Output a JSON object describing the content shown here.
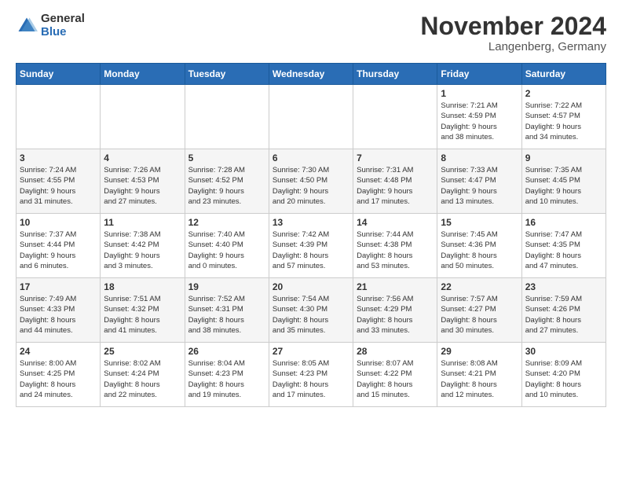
{
  "header": {
    "logo_general": "General",
    "logo_blue": "Blue",
    "title": "November 2024",
    "location": "Langenberg, Germany"
  },
  "columns": [
    "Sunday",
    "Monday",
    "Tuesday",
    "Wednesday",
    "Thursday",
    "Friday",
    "Saturday"
  ],
  "weeks": [
    [
      {
        "day": "",
        "info": ""
      },
      {
        "day": "",
        "info": ""
      },
      {
        "day": "",
        "info": ""
      },
      {
        "day": "",
        "info": ""
      },
      {
        "day": "",
        "info": ""
      },
      {
        "day": "1",
        "info": "Sunrise: 7:21 AM\nSunset: 4:59 PM\nDaylight: 9 hours\nand 38 minutes."
      },
      {
        "day": "2",
        "info": "Sunrise: 7:22 AM\nSunset: 4:57 PM\nDaylight: 9 hours\nand 34 minutes."
      }
    ],
    [
      {
        "day": "3",
        "info": "Sunrise: 7:24 AM\nSunset: 4:55 PM\nDaylight: 9 hours\nand 31 minutes."
      },
      {
        "day": "4",
        "info": "Sunrise: 7:26 AM\nSunset: 4:53 PM\nDaylight: 9 hours\nand 27 minutes."
      },
      {
        "day": "5",
        "info": "Sunrise: 7:28 AM\nSunset: 4:52 PM\nDaylight: 9 hours\nand 23 minutes."
      },
      {
        "day": "6",
        "info": "Sunrise: 7:30 AM\nSunset: 4:50 PM\nDaylight: 9 hours\nand 20 minutes."
      },
      {
        "day": "7",
        "info": "Sunrise: 7:31 AM\nSunset: 4:48 PM\nDaylight: 9 hours\nand 17 minutes."
      },
      {
        "day": "8",
        "info": "Sunrise: 7:33 AM\nSunset: 4:47 PM\nDaylight: 9 hours\nand 13 minutes."
      },
      {
        "day": "9",
        "info": "Sunrise: 7:35 AM\nSunset: 4:45 PM\nDaylight: 9 hours\nand 10 minutes."
      }
    ],
    [
      {
        "day": "10",
        "info": "Sunrise: 7:37 AM\nSunset: 4:44 PM\nDaylight: 9 hours\nand 6 minutes."
      },
      {
        "day": "11",
        "info": "Sunrise: 7:38 AM\nSunset: 4:42 PM\nDaylight: 9 hours\nand 3 minutes."
      },
      {
        "day": "12",
        "info": "Sunrise: 7:40 AM\nSunset: 4:40 PM\nDaylight: 9 hours\nand 0 minutes."
      },
      {
        "day": "13",
        "info": "Sunrise: 7:42 AM\nSunset: 4:39 PM\nDaylight: 8 hours\nand 57 minutes."
      },
      {
        "day": "14",
        "info": "Sunrise: 7:44 AM\nSunset: 4:38 PM\nDaylight: 8 hours\nand 53 minutes."
      },
      {
        "day": "15",
        "info": "Sunrise: 7:45 AM\nSunset: 4:36 PM\nDaylight: 8 hours\nand 50 minutes."
      },
      {
        "day": "16",
        "info": "Sunrise: 7:47 AM\nSunset: 4:35 PM\nDaylight: 8 hours\nand 47 minutes."
      }
    ],
    [
      {
        "day": "17",
        "info": "Sunrise: 7:49 AM\nSunset: 4:33 PM\nDaylight: 8 hours\nand 44 minutes."
      },
      {
        "day": "18",
        "info": "Sunrise: 7:51 AM\nSunset: 4:32 PM\nDaylight: 8 hours\nand 41 minutes."
      },
      {
        "day": "19",
        "info": "Sunrise: 7:52 AM\nSunset: 4:31 PM\nDaylight: 8 hours\nand 38 minutes."
      },
      {
        "day": "20",
        "info": "Sunrise: 7:54 AM\nSunset: 4:30 PM\nDaylight: 8 hours\nand 35 minutes."
      },
      {
        "day": "21",
        "info": "Sunrise: 7:56 AM\nSunset: 4:29 PM\nDaylight: 8 hours\nand 33 minutes."
      },
      {
        "day": "22",
        "info": "Sunrise: 7:57 AM\nSunset: 4:27 PM\nDaylight: 8 hours\nand 30 minutes."
      },
      {
        "day": "23",
        "info": "Sunrise: 7:59 AM\nSunset: 4:26 PM\nDaylight: 8 hours\nand 27 minutes."
      }
    ],
    [
      {
        "day": "24",
        "info": "Sunrise: 8:00 AM\nSunset: 4:25 PM\nDaylight: 8 hours\nand 24 minutes."
      },
      {
        "day": "25",
        "info": "Sunrise: 8:02 AM\nSunset: 4:24 PM\nDaylight: 8 hours\nand 22 minutes."
      },
      {
        "day": "26",
        "info": "Sunrise: 8:04 AM\nSunset: 4:23 PM\nDaylight: 8 hours\nand 19 minutes."
      },
      {
        "day": "27",
        "info": "Sunrise: 8:05 AM\nSunset: 4:23 PM\nDaylight: 8 hours\nand 17 minutes."
      },
      {
        "day": "28",
        "info": "Sunrise: 8:07 AM\nSunset: 4:22 PM\nDaylight: 8 hours\nand 15 minutes."
      },
      {
        "day": "29",
        "info": "Sunrise: 8:08 AM\nSunset: 4:21 PM\nDaylight: 8 hours\nand 12 minutes."
      },
      {
        "day": "30",
        "info": "Sunrise: 8:09 AM\nSunset: 4:20 PM\nDaylight: 8 hours\nand 10 minutes."
      }
    ]
  ]
}
